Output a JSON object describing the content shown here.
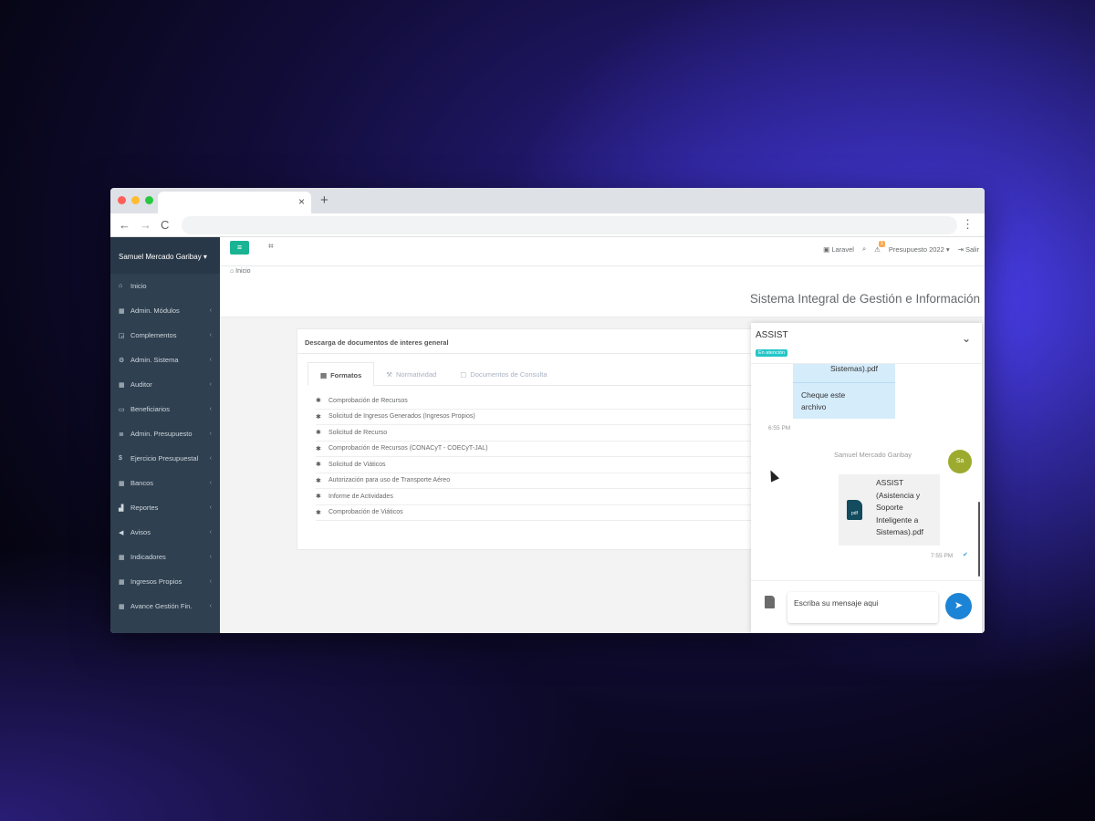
{
  "browser": {
    "tab_close": "×",
    "new_tab": "+",
    "back": "←",
    "forward": "→",
    "reload": "C",
    "menu": "⋮",
    "window_colors": [
      "#ff5f57",
      "#febc2e",
      "#28c840"
    ]
  },
  "sidebar": {
    "user": "Samuel Mercado Garibay ▾",
    "items": [
      {
        "label": "Inicio",
        "icon": "home-icon",
        "glyph": "⌂",
        "chevron": ""
      },
      {
        "label": "Admin. Módulos",
        "icon": "grid-icon",
        "glyph": "▦",
        "chevron": "‹"
      },
      {
        "label": "Complementos",
        "icon": "puzzle-icon",
        "glyph": "◲",
        "chevron": "‹"
      },
      {
        "label": "Admin. Sistema",
        "icon": "gears-icon",
        "glyph": "⚙",
        "chevron": "‹"
      },
      {
        "label": "Auditor",
        "icon": "grid-icon",
        "glyph": "▦",
        "chevron": "‹"
      },
      {
        "label": "Beneficiarios",
        "icon": "card-icon",
        "glyph": "▭",
        "chevron": "‹"
      },
      {
        "label": "Admin. Presupuesto",
        "icon": "list-icon",
        "glyph": "≣",
        "chevron": "‹"
      },
      {
        "label": "Ejercicio Presupuestal",
        "icon": "dollar-icon",
        "glyph": "$",
        "chevron": "‹"
      },
      {
        "label": "Bancos",
        "icon": "grid-icon",
        "glyph": "▦",
        "chevron": "‹"
      },
      {
        "label": "Reportes",
        "icon": "chart-icon",
        "glyph": "▟",
        "chevron": "‹"
      },
      {
        "label": "Avisos",
        "icon": "bullhorn-icon",
        "glyph": "◀",
        "chevron": "‹"
      },
      {
        "label": "Indicadores",
        "icon": "grid-icon",
        "glyph": "▦",
        "chevron": "‹"
      },
      {
        "label": "Ingresos Propios",
        "icon": "grid-icon",
        "glyph": "▦",
        "chevron": "‹"
      },
      {
        "label": "Avance Gestión Fin.",
        "icon": "grid-icon",
        "glyph": "▦",
        "chevron": "‹"
      }
    ]
  },
  "topnav": {
    "menu_glyph": "≡",
    "map_glyph": "⌗",
    "laravel": "Laravel",
    "search_glyph": "⌕",
    "alert_badge": "1",
    "budget": "Presupuesto 2022 ▾",
    "logout": "Salir"
  },
  "breadcrumb": "⌂ Inicio",
  "system_title": "Sistema Integral de Gestión e Información",
  "panel": {
    "title": "Descarga de documentos de interes general",
    "tabs": [
      {
        "label": "Formatos",
        "glyph": "▤"
      },
      {
        "label": "Normatividad",
        "glyph": "⚒"
      },
      {
        "label": "Documentos de Consulta",
        "glyph": "▢"
      }
    ],
    "documents": [
      "Comprobación de Recursos",
      "Solicitud de Ingresos Generados (Ingresos Propios)",
      "Solicitud de Recurso",
      "Comprobación de Recursos (CONACyT - COECyT-JAL)",
      "Solicitud de Viáticos",
      "Autorización para uso de Transporte Aéreo",
      "Informe de Actividades",
      "Comprobación de Viáticos"
    ],
    "doc_glyph": "✱"
  },
  "chat": {
    "title": "ASSIST",
    "status": "En atención",
    "collapse_glyph": "⌄",
    "incoming": {
      "file_tail": "Sistemas).pdf",
      "text_line1": "Cheque este",
      "text_line2": "archivo",
      "time": "6:55 PM"
    },
    "outgoing": {
      "sender": "Samuel Mercado Garibay",
      "avatar": "Sa",
      "pdf_label": "pdf",
      "file_lines": [
        "ASSIST",
        "(Asistencia y",
        "Soporte",
        "Inteligente a",
        "Sistemas).pdf"
      ],
      "time": "7:55 PM",
      "check": "✔"
    },
    "input_placeholder": "Escriba su mensaje aqui",
    "send_glyph": "➤"
  }
}
